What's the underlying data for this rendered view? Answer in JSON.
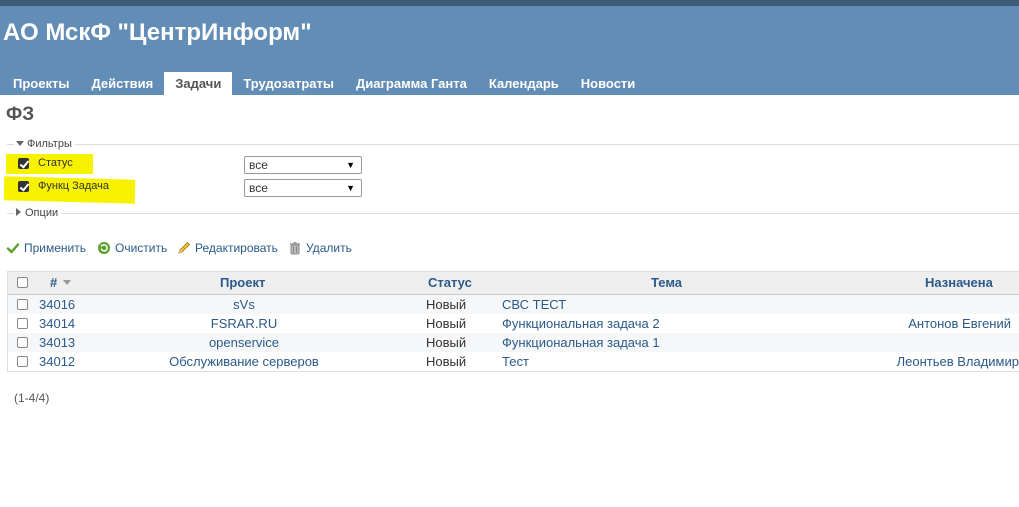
{
  "header": {
    "app_title": "АО МскФ \"ЦентрИнформ\"",
    "tabs": [
      {
        "label": "Проекты",
        "selected": false
      },
      {
        "label": "Действия",
        "selected": false
      },
      {
        "label": "Задачи",
        "selected": true
      },
      {
        "label": "Трудозатраты",
        "selected": false
      },
      {
        "label": "Диаграмма Ганта",
        "selected": false
      },
      {
        "label": "Календарь",
        "selected": false
      },
      {
        "label": "Новости",
        "selected": false
      }
    ]
  },
  "page_title": "ФЗ",
  "filters": {
    "legend": "Фильтры",
    "expanded": true,
    "items": [
      {
        "label": "Статус",
        "checked": true,
        "operator": "все"
      },
      {
        "label": "Функц Задача",
        "checked": true,
        "operator": "все"
      }
    ]
  },
  "options": {
    "legend": "Опции",
    "expanded": false
  },
  "actions": {
    "apply": "Применить",
    "clear": "Очистить",
    "edit": "Редактировать",
    "delete": "Удалить"
  },
  "table": {
    "columns": {
      "number": "#",
      "project": "Проект",
      "status": "Статус",
      "subject": "Тема",
      "assignee": "Назначена"
    },
    "rows": [
      {
        "id": "34016",
        "project": "sVs",
        "status": "Новый",
        "subject": "СВС ТЕСТ",
        "assignee": ""
      },
      {
        "id": "34014",
        "project": "FSRAR.RU",
        "status": "Новый",
        "subject": "Функциональная задача 2",
        "assignee": "Антонов Евгений"
      },
      {
        "id": "34013",
        "project": "openservice",
        "status": "Новый",
        "subject": "Функциональная задача 1",
        "assignee": ""
      },
      {
        "id": "34012",
        "project": "Обслуживание серверов",
        "status": "Новый",
        "subject": "Тест",
        "assignee": "Леонтьев Владимир"
      }
    ]
  },
  "pagination": "(1-4/4)",
  "colors": {
    "header_bg": "#628db6",
    "top_strip": "#3e5b76",
    "link": "#2a5a8a",
    "highlight": "#f7f200"
  }
}
